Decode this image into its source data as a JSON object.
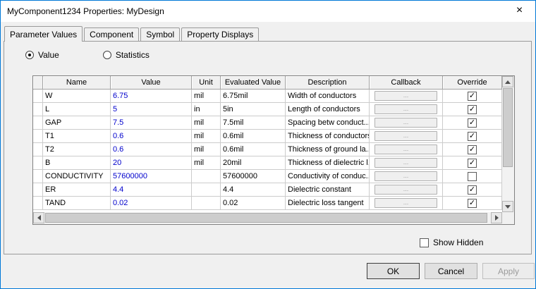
{
  "window": {
    "title": "MyComponent1234 Properties: MyDesign",
    "close_glyph": "×"
  },
  "tabs": [
    {
      "label": "Parameter Values",
      "active": true
    },
    {
      "label": "Component",
      "active": false
    },
    {
      "label": "Symbol",
      "active": false
    },
    {
      "label": "Property Displays",
      "active": false
    }
  ],
  "radios": [
    {
      "label": "Value",
      "selected": true
    },
    {
      "label": "Statistics",
      "selected": false
    }
  ],
  "table": {
    "headers": [
      "",
      "Name",
      "Value",
      "Unit",
      "Evaluated Value",
      "Description",
      "Callback",
      "Override"
    ],
    "callback_button_label": "...",
    "rows": [
      {
        "name": "W",
        "value": "6.75",
        "unit": "mil",
        "evaluated_value": "6.75mil",
        "description": "Width of conductors",
        "override": true
      },
      {
        "name": "L",
        "value": "5",
        "unit": "in",
        "evaluated_value": "5in",
        "description": "Length of conductors",
        "override": true
      },
      {
        "name": "GAP",
        "value": "7.5",
        "unit": "mil",
        "evaluated_value": "7.5mil",
        "description": "Spacing betw conduct...",
        "override": true
      },
      {
        "name": "T1",
        "value": "0.6",
        "unit": "mil",
        "evaluated_value": "0.6mil",
        "description": "Thickness of conductors",
        "override": true
      },
      {
        "name": "T2",
        "value": "0.6",
        "unit": "mil",
        "evaluated_value": "0.6mil",
        "description": "Thickness of ground la...",
        "override": true
      },
      {
        "name": "B",
        "value": "20",
        "unit": "mil",
        "evaluated_value": "20mil",
        "description": "Thickness of dielectric l...",
        "override": true
      },
      {
        "name": "CONDUCTIVITY",
        "value": "57600000",
        "unit": "",
        "evaluated_value": "57600000",
        "description": "Conductivity of conduc...",
        "override": false
      },
      {
        "name": "ER",
        "value": "4.4",
        "unit": "",
        "evaluated_value": "4.4",
        "description": "Dielectric constant",
        "override": true
      },
      {
        "name": "TAND",
        "value": "0.02",
        "unit": "",
        "evaluated_value": "0.02",
        "description": "Dielectric loss tangent",
        "override": true
      }
    ]
  },
  "show_hidden_label": "Show Hidden",
  "buttons": {
    "ok": "OK",
    "cancel": "Cancel",
    "apply": "Apply"
  },
  "colors": {
    "value_text": "#0000cc",
    "window_border": "#0078d7"
  }
}
